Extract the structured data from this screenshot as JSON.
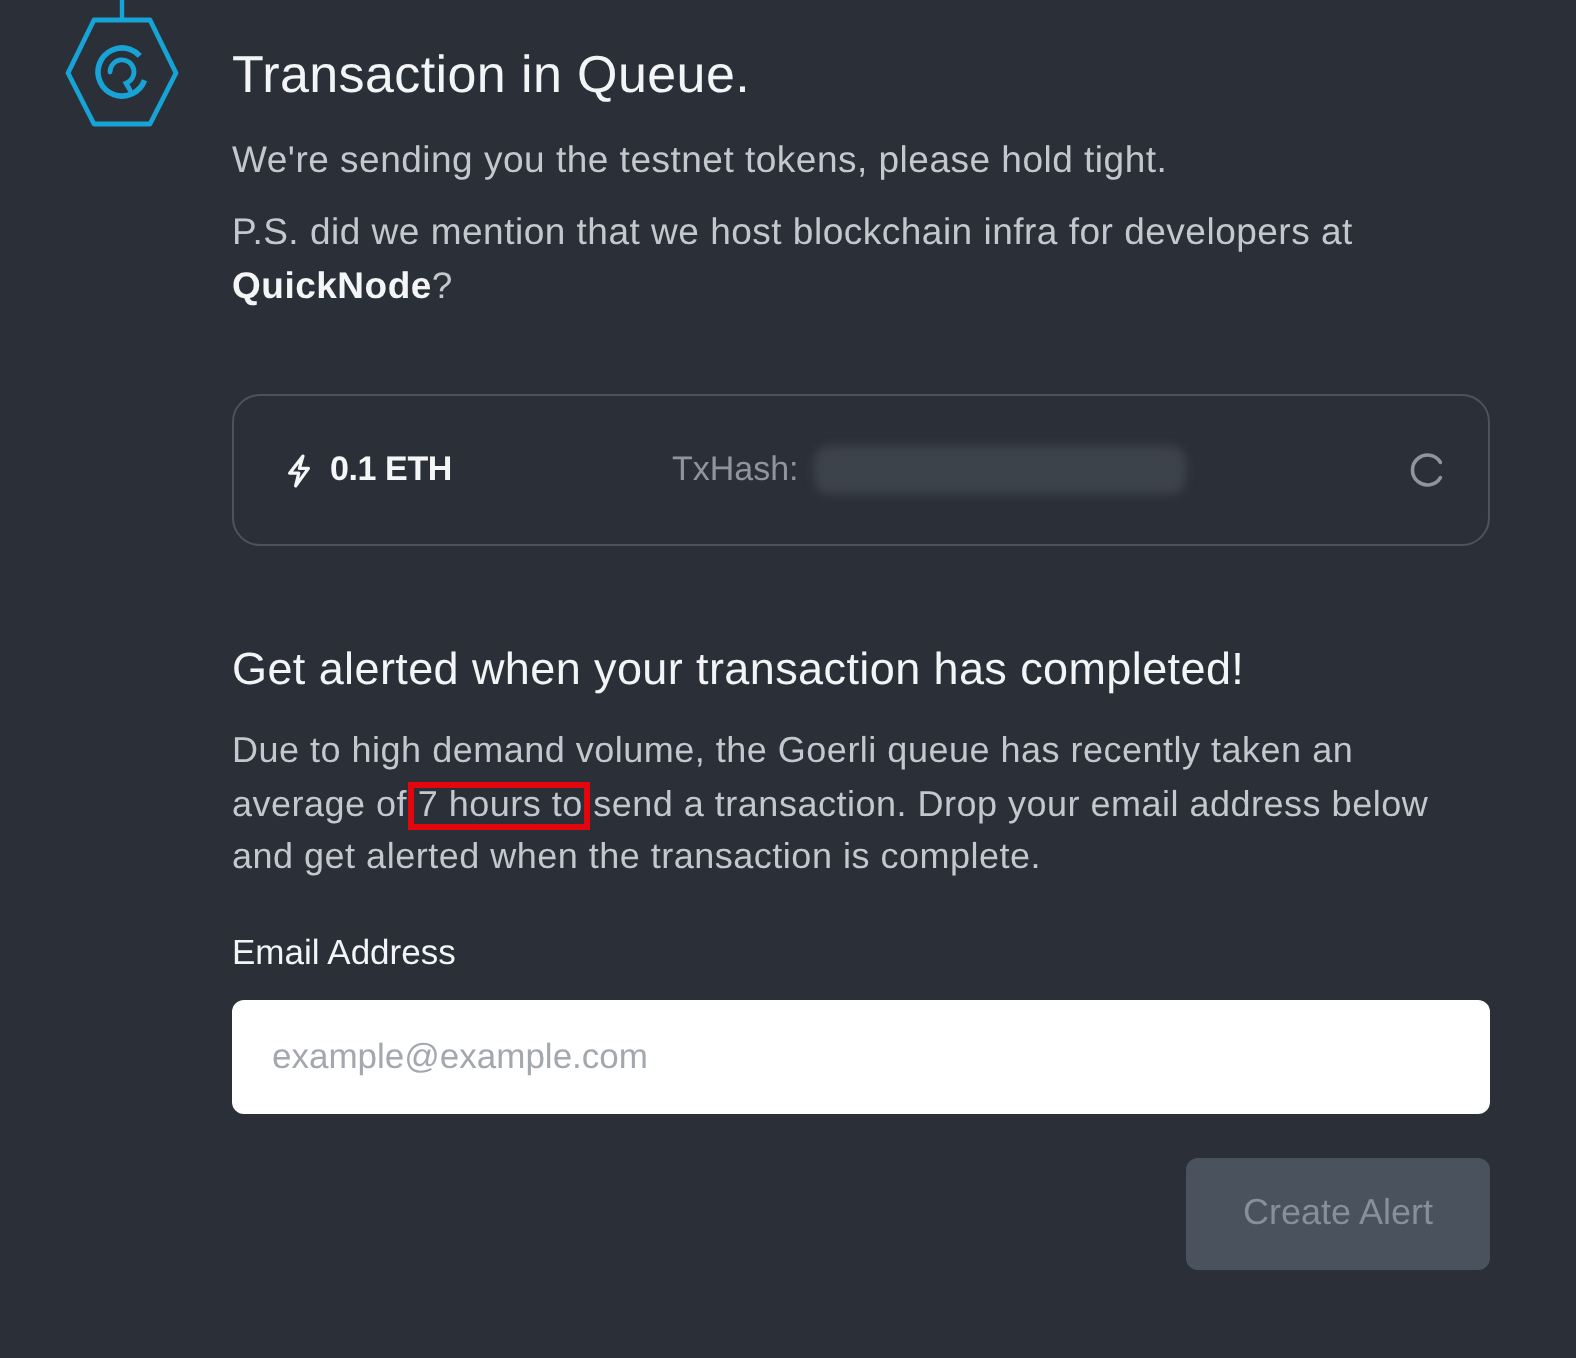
{
  "header": {
    "title": "Transaction in Queue.",
    "lines": [
      "We're sending you the testnet tokens, please hold tight.",
      "P.S. did we mention that we host blockchain infra for developers at **QuickNode**?"
    ]
  },
  "transaction": {
    "amount": "0.1 ETH",
    "hash_label": "TxHash:",
    "hash_redacted": true,
    "pending": true
  },
  "alert": {
    "heading": "Get alerted when your transaction has completed!",
    "segments": [
      {
        "text": "Due to high demand volume, the Goerli queue has recently taken an average of ",
        "highlighted": false
      },
      {
        "text": "7 hours to",
        "highlighted": true
      },
      {
        "text": " send a transaction. Drop your email address below and get alerted when the transaction is complete.",
        "highlighted": false
      }
    ],
    "email": {
      "label": "Email Address",
      "placeholder": "example@example.com"
    },
    "button": {
      "label": "Create Alert",
      "disabled": true
    }
  }
}
